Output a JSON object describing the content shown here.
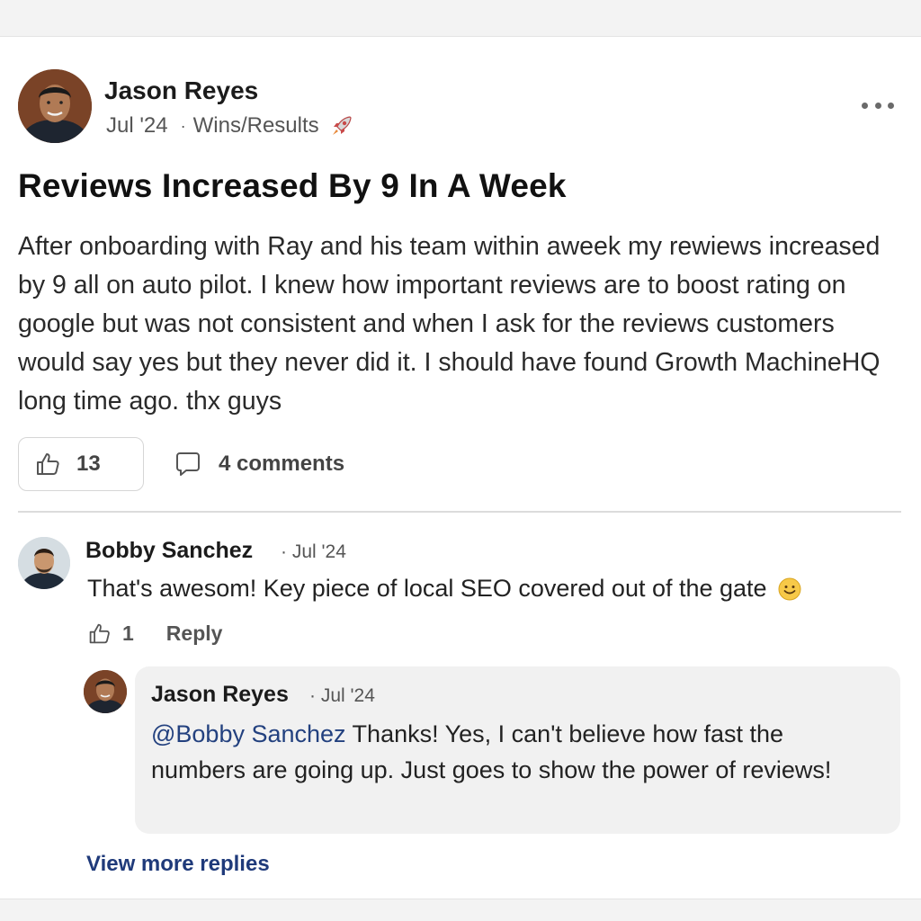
{
  "post": {
    "author": "Jason Reyes",
    "date": "Jul '24",
    "separator": "·",
    "category": "Wins/Results",
    "category_icon": "rocket-icon",
    "title": "Reviews Increased By 9 In A Week",
    "body": "After onboarding with Ray and his team within aweek my rewiews increased by 9 all on auto pilot. I knew how important reviews are to boost rating on google but was not consistent and when I ask for the reviews customers would say yes but they never did it. I should have found Growth MachineHQ long time ago. thx guys",
    "likes": "13",
    "comments_label": "4 comments"
  },
  "comment": {
    "author": "Bobby Sanchez",
    "time": "· Jul '24",
    "text": "That's awesom! Key piece of local SEO covered out of the gate",
    "emoji": "smiley-emoji",
    "likes": "1",
    "reply_label": "Reply"
  },
  "reply": {
    "author": "Jason Reyes",
    "time": "· Jul '24",
    "mention": "@Bobby Sanchez",
    "text": " Thanks! Yes, I can't believe how fast the numbers are going up. Just goes to show the power of reviews!"
  },
  "view_more_label": "View more replies",
  "colors": {
    "link": "#23417f",
    "view_more": "#1f3a7a",
    "bubble_bg": "#f1f1f1"
  }
}
